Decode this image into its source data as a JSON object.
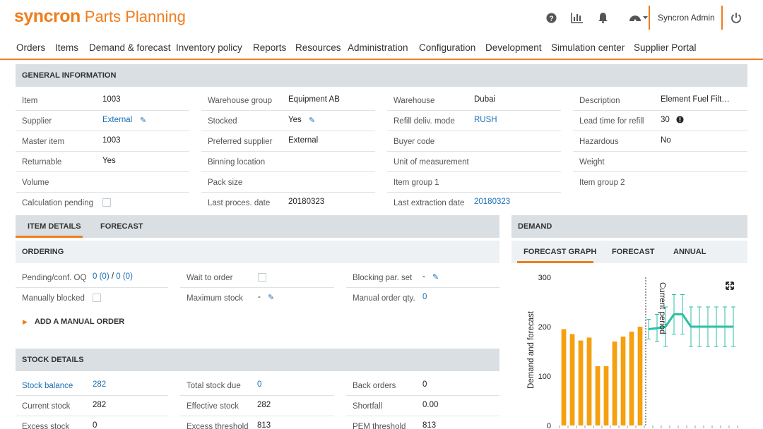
{
  "header": {
    "brand": "syncron",
    "product": "Parts Planning",
    "user": "Syncron Admin",
    "icons": [
      "help-icon",
      "reports-chart-icon",
      "notifications-bell-icon",
      "dashboard-gauge-icon",
      "power-icon"
    ]
  },
  "nav": [
    "Orders",
    "Items",
    "Demand & forecast",
    "Inventory policy",
    "Reports",
    "Resources",
    "Administration",
    "Configuration",
    "Development",
    "Simulation center",
    "Supplier Portal"
  ],
  "general": {
    "title": "GENERAL INFORMATION",
    "col1": [
      {
        "label": "Item",
        "value": "1003"
      },
      {
        "label": "Supplier",
        "value": "External"
      },
      {
        "label": "Master item",
        "value": "1003"
      },
      {
        "label": "Returnable",
        "value": "Yes"
      },
      {
        "label": "Volume",
        "value": ""
      },
      {
        "label": "Calculation pending",
        "value": ""
      }
    ],
    "col2": [
      {
        "label": "Warehouse group",
        "value": "Equipment AB"
      },
      {
        "label": "Stocked",
        "value": "Yes"
      },
      {
        "label": "Preferred supplier",
        "value": "External"
      },
      {
        "label": "Binning location",
        "value": ""
      },
      {
        "label": "Pack size",
        "value": ""
      },
      {
        "label": "Last proces. date",
        "value": "20180323"
      }
    ],
    "col3": [
      {
        "label": "Warehouse",
        "value": "Dubai"
      },
      {
        "label": "Refill deliv. mode",
        "value": "RUSH"
      },
      {
        "label": "Buyer code",
        "value": ""
      },
      {
        "label": "Unit of measurement",
        "value": ""
      },
      {
        "label": "Item group 1",
        "value": ""
      },
      {
        "label": "Last extraction date",
        "value": "20180323"
      }
    ],
    "col4": [
      {
        "label": "Description",
        "value": "Element Fuel Filt…"
      },
      {
        "label": "Lead time for refill",
        "value": "30"
      },
      {
        "label": "Hazardous",
        "value": "No"
      },
      {
        "label": "Weight",
        "value": ""
      },
      {
        "label": "Item group 2",
        "value": ""
      }
    ]
  },
  "item_tabs": [
    "ITEM DETAILS",
    "FORECAST"
  ],
  "ordering": {
    "title": "ORDERING",
    "pending_label": "Pending/conf. OQ",
    "pending_a": "0 (0)",
    "pending_sep": " / ",
    "pending_b": "0 (0)",
    "wait_label": "Wait to order",
    "blocking_label": "Blocking par. set",
    "blocking_value": "-",
    "manually_blocked_label": "Manually blocked",
    "max_stock_label": "Maximum stock",
    "max_stock_value": "-",
    "manual_qty_label": "Manual order qty.",
    "manual_qty_value": "0",
    "add_manual_order": "ADD A MANUAL ORDER"
  },
  "stock": {
    "title": "STOCK DETAILS",
    "rows": [
      [
        {
          "label": "Stock balance",
          "value": "282"
        },
        {
          "label": "Total stock due",
          "value": "0"
        },
        {
          "label": "Back orders",
          "value": "0"
        }
      ],
      [
        {
          "label": "Current stock",
          "value": "282"
        },
        {
          "label": "Effective stock",
          "value": "282"
        },
        {
          "label": "Shortfall",
          "value": "0.00"
        }
      ],
      [
        {
          "label": "Excess stock",
          "value": "0"
        },
        {
          "label": "Excess threshold",
          "value": "813"
        },
        {
          "label": "PEM threshold",
          "value": "813"
        }
      ]
    ]
  },
  "demand": {
    "title": "DEMAND",
    "tabs": [
      "FORECAST GRAPH",
      "FORECAST",
      "ANNUAL"
    ]
  },
  "colors": {
    "accent": "#f07d1a",
    "bar": "#f5a00f",
    "forecast": "#2bbfa4",
    "link": "#1a6fb5"
  },
  "chart_data": {
    "type": "bar",
    "ylabel": "Demand and forecast",
    "ylim": [
      0,
      300
    ],
    "yticks": [
      0,
      100,
      200,
      300
    ],
    "annotation": "Current period",
    "history_values": [
      195,
      185,
      172,
      178,
      120,
      120,
      170,
      180,
      190,
      200
    ],
    "forecast": {
      "values": [
        195,
        197,
        200,
        225,
        225,
        200,
        200,
        200,
        200,
        200,
        200
      ],
      "upper": [
        215,
        225,
        240,
        265,
        265,
        240,
        240,
        240,
        240,
        240,
        240
      ],
      "lower": [
        175,
        170,
        160,
        185,
        185,
        160,
        160,
        160,
        160,
        160,
        160
      ]
    }
  }
}
